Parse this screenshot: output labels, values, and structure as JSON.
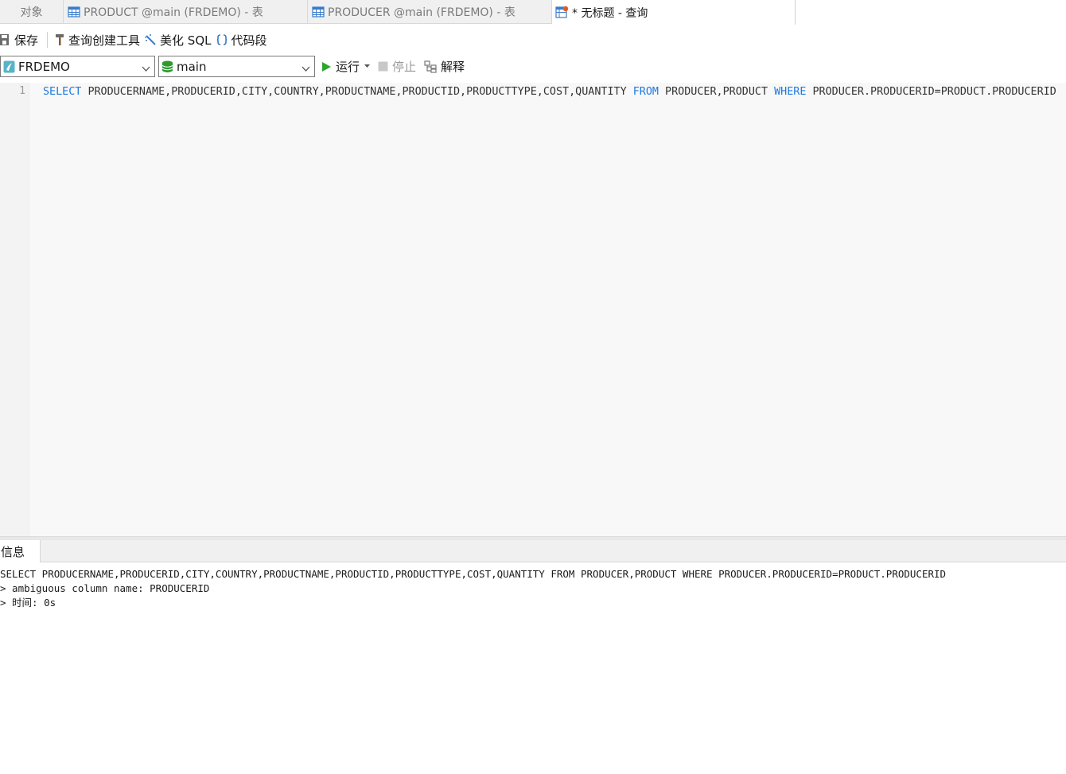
{
  "tabs": [
    {
      "label": "对象",
      "icon": ""
    },
    {
      "label": "PRODUCT @main (FRDEMO) - 表",
      "icon": "table-icon"
    },
    {
      "label": "PRODUCER @main (FRDEMO) - 表",
      "icon": "table-icon"
    },
    {
      "label": "* 无标题 - 查询",
      "icon": "query-icon",
      "active": true
    }
  ],
  "toolbar": {
    "save": "保存",
    "query_builder": "查询创建工具",
    "beautify": "美化 SQL",
    "snippet": "代码段"
  },
  "selectors": {
    "connection": "FRDEMO",
    "database": "main"
  },
  "runbar": {
    "run": "运行",
    "stop": "停止",
    "explain": "解释"
  },
  "editor": {
    "line_number": "1",
    "sql": {
      "kw_select": "SELECT",
      "columns": "PRODUCERNAME,PRODUCERID,CITY,COUNTRY,PRODUCTNAME,PRODUCTID,PRODUCTTYPE,COST,QUANTITY",
      "kw_from": "FROM",
      "tables": "PRODUCER,PRODUCT",
      "kw_where": "WHERE",
      "condition": "PRODUCER.PRODUCERID=PRODUCT.PRODUCERID"
    }
  },
  "result": {
    "tab_label": "信息",
    "lines": [
      "SELECT PRODUCERNAME,PRODUCERID,CITY,COUNTRY,PRODUCTNAME,PRODUCTID,PRODUCTTYPE,COST,QUANTITY FROM PRODUCER,PRODUCT WHERE PRODUCER.PRODUCERID=PRODUCT.PRODUCERID",
      "> ambiguous column name: PRODUCERID",
      "> 时间: 0s"
    ]
  },
  "colors": {
    "keyword": "#1d7ae0",
    "run_green": "#2ea52e",
    "db_green": "#2e9a2e",
    "table_blue": "#3a7bc8"
  }
}
